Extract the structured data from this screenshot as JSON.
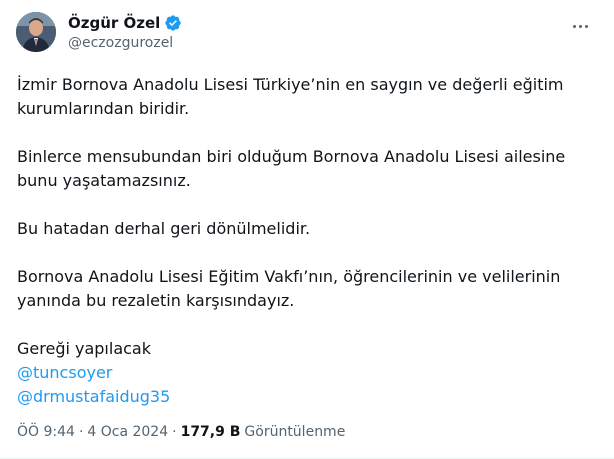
{
  "author": {
    "display_name": "Özgür Özel",
    "handle": "@eczozgurozel",
    "verified_badge_color": "#1d9bf0",
    "avatar_icon": "profile-photo"
  },
  "more_icon": "more-options-icon",
  "tweet": {
    "paragraphs": [
      "İzmir Bornova Anadolu Lisesi Türkiye’nin en saygın ve değerli eğitim\nkurumlarından biridir.",
      "Binlerce mensubundan biri olduğum Bornova Anadolu Lisesi ailesine\nbunu yaşatamazsınız.",
      "Bu hatadan derhal geri dönülmelidir.",
      "Bornova Anadolu Lisesi Eğitim Vakfı’nın, öğrencilerinin ve velilerinin\nyanında bu rezaletin karşısındayız."
    ],
    "closing": "Gereği yapılacak",
    "mentions": [
      "@tuncsoyer",
      "@drmustafaidug35"
    ]
  },
  "meta": {
    "time": "ÖÖ 9:44",
    "separator": "·",
    "date": "4 Oca 2024",
    "views_count": "177,9 B",
    "views_label": "Görüntülenme"
  },
  "colors": {
    "link": "#1d9bf0",
    "secondary_text": "#536471",
    "primary_text": "#0f1419"
  }
}
